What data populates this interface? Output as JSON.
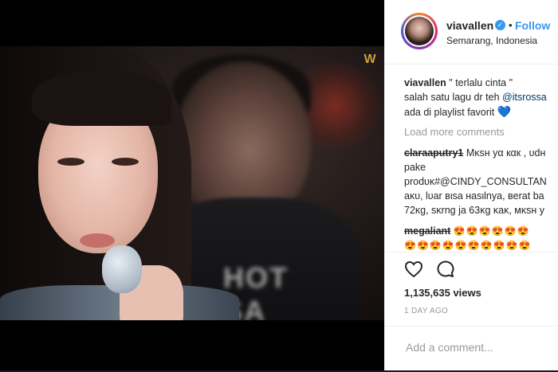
{
  "post": {
    "username": "viavallen",
    "verified_mark": "✓",
    "dot": "•",
    "follow_label": "Follow",
    "location": "Semarang, Indonesia"
  },
  "caption": {
    "username": "viavallen",
    "line1": " \" terlalu cinta \"",
    "line2": "salah satu lagu dr teh ",
    "mention": "@itsrossa",
    "line3": "ada di playlist favorit",
    "emoji": "💙"
  },
  "load_more": "Load more comments",
  "comments": [
    {
      "username": "claraaputry1",
      "lines": [
        " Mĸѕн уα кαк , υdн",
        "pake",
        "prodυĸ#@CINDY_CONSULTAN",
        "aĸυ, lυar вιѕa нaѕιlnya, вerat ba",
        "72ĸg, ѕĸrng ja 63ĸg ĸaĸ, мĸѕн у"
      ]
    },
    {
      "username": "megaliant",
      "emoji_line1": "😍😍😍😍😍😍",
      "emoji_line2": "😍😍😍😍😍😍😍😍😍😍"
    }
  ],
  "stats": {
    "views": "1,135,635 views",
    "time": "1 DAY AGO"
  },
  "add_comment": {
    "placeholder": "Add a comment..."
  },
  "video": {
    "watermark": "W",
    "shirt_text": "HOT SA"
  },
  "icons": {
    "like": "heart-outline-icon",
    "comment": "speech-bubble-icon",
    "verified": "verified-badge-icon"
  },
  "colors": {
    "accent": "#3897f0",
    "text": "#262626",
    "muted": "#999999",
    "link": "#003569"
  }
}
